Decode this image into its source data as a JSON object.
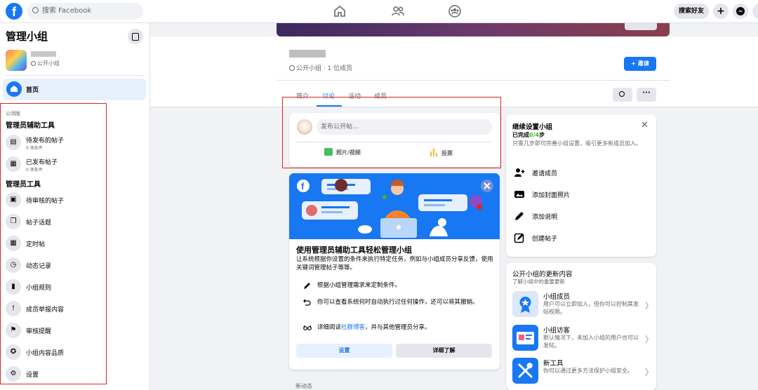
{
  "topbar": {
    "search_placeholder": "搜索 Facebook",
    "find_friends": "搜索好友",
    "logo_letter": "f"
  },
  "sidebar": {
    "title": "管理小组",
    "group_privacy": "公开小组",
    "home": "首页",
    "beta_note": "公测版",
    "assist_header": "管理员辅助工具",
    "assist_items": [
      {
        "label": "待发布的帖子",
        "sub": "0 项条件"
      },
      {
        "label": "已发布帖子",
        "sub": "0 项条件"
      }
    ],
    "admin_header": "管理员工具",
    "admin_items": [
      {
        "label": "待审核的帖子",
        "icon": "pending-posts-icon"
      },
      {
        "label": "帖子话题",
        "icon": "topics-icon"
      },
      {
        "label": "定时帖",
        "icon": "calendar-icon"
      },
      {
        "label": "动态记录",
        "icon": "clock-icon"
      },
      {
        "label": "小组规则",
        "icon": "book-icon"
      },
      {
        "label": "成员举报内容",
        "icon": "report-icon"
      },
      {
        "label": "审核提醒",
        "icon": "alert-icon"
      },
      {
        "label": "小组内容品质",
        "icon": "quality-icon"
      },
      {
        "label": "设置",
        "icon": "gear-icon"
      }
    ]
  },
  "group": {
    "meta": "公开小组 · 1 位成员",
    "invite": "+ 邀请",
    "tabs": [
      "简介",
      "讨论",
      "活动",
      "成员"
    ],
    "active_tab": "讨论"
  },
  "composer": {
    "placeholder": "发布公开帖...",
    "photo": "照片/视频",
    "poll": "投票"
  },
  "promo": {
    "title": "使用管理员辅助工具轻松管理小组",
    "desc": "让系统根据你设置的条件来执行特定任务，例如与小组成员分享反馈，使用关键词管理帖子等等。",
    "row1": "根据小组管理需求来定制条件。",
    "row2": "你可以查看系统何时自动执行过任何操作，还可以将其撤销。",
    "row3_pre": "详细阅读",
    "row3_link": "社群博客",
    "row3_post": "，并与其他管理员分享。",
    "btn_settings": "设置",
    "btn_learn": "详细了解"
  },
  "feed": {
    "news_label": "新动态"
  },
  "setup": {
    "title": "继续设置小组",
    "progress_pre": "已完成",
    "progress_count": "0/4",
    "progress_post": "步",
    "hint": "只需几步即可完善小组设置，吸引更多新成员加入。",
    "items": [
      "邀请成员",
      "添加封面照片",
      "添加说明",
      "创建帖子"
    ]
  },
  "updates": {
    "title": "公开小组的更新内容",
    "sub": "了解小组中的重要更新",
    "items": [
      {
        "title": "小组成员",
        "desc": "用户可以立即加入，但你可以控制其发帖权限。"
      },
      {
        "title": "小组访客",
        "desc": "默认情况下，未加入小组的用户也可以发帖。"
      },
      {
        "title": "新工具",
        "desc": "你可以通过更多方法保护小组安全。"
      }
    ]
  },
  "colors": {
    "brand": "#1877f2",
    "highlight_box": "#e02424",
    "success": "#42b72a"
  }
}
